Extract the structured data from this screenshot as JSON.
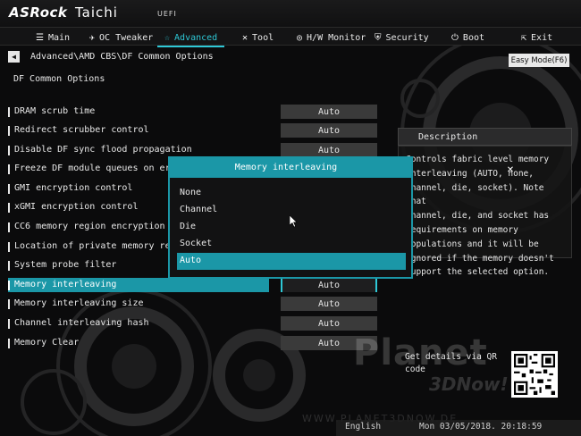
{
  "header": {
    "brand": "ASRock",
    "model": "Taichi",
    "firmware": "UEFI"
  },
  "nav": {
    "items": [
      {
        "label": "Main",
        "icon": "list-icon"
      },
      {
        "label": "OC Tweaker",
        "icon": "rocket-icon"
      },
      {
        "label": "Advanced",
        "icon": "star-icon",
        "active": true
      },
      {
        "label": "Tool",
        "icon": "tools-icon"
      },
      {
        "label": "H/W Monitor",
        "icon": "monitor-icon"
      },
      {
        "label": "Security",
        "icon": "shield-icon"
      },
      {
        "label": "Boot",
        "icon": "power-icon"
      },
      {
        "label": "Exit",
        "icon": "exit-icon"
      }
    ]
  },
  "breadcrumb": "Advanced\\AMD CBS\\DF Common Options",
  "easy_mode": "Easy Mode(F6)",
  "section_title": "DF Common Options",
  "settings": [
    {
      "label": "DRAM scrub time",
      "value": "Auto"
    },
    {
      "label": "Redirect scrubber control",
      "value": "Auto"
    },
    {
      "label": "Disable DF sync flood propagation",
      "value": "Auto"
    },
    {
      "label": "Freeze DF module queues on error",
      "value": ""
    },
    {
      "label": "GMI encryption control",
      "value": ""
    },
    {
      "label": "xGMI encryption control",
      "value": ""
    },
    {
      "label": "CC6 memory region encryption",
      "value": ""
    },
    {
      "label": "Location of private memory regions",
      "value": ""
    },
    {
      "label": "System probe filter",
      "value": ""
    },
    {
      "label": "Memory interleaving",
      "value": "Auto",
      "selected": true
    },
    {
      "label": "Memory interleaving size",
      "value": "Auto"
    },
    {
      "label": "Channel interleaving hash",
      "value": "Auto"
    },
    {
      "label": "Memory Clear",
      "value": "Auto"
    }
  ],
  "description": {
    "title": "Description",
    "lines": [
      "Controls fabric level memory",
      "interleaving (AUTO, none,",
      "channel, die, socket). Note that",
      "channel, die, and socket has",
      "requirements on memory",
      "populations and it will be",
      "ignored if the memory doesn't",
      "support the selected option."
    ]
  },
  "qr_label": "Get details via QR code",
  "popup": {
    "title": "Memory interleaving",
    "options": [
      "None",
      "Channel",
      "Die",
      "Socket",
      "Auto"
    ],
    "selected": "Auto"
  },
  "footer": {
    "language": "English",
    "datetime": "Mon 03/05/2018. 20:18:59"
  },
  "watermark": {
    "line1": "Planet",
    "line2": "3DNow!",
    "url": "WWW.PLANET3DNOW.DE"
  },
  "colors": {
    "accent": "#1b97a7",
    "accent_light": "#2ec8d6",
    "background": "#0b0b0c"
  }
}
